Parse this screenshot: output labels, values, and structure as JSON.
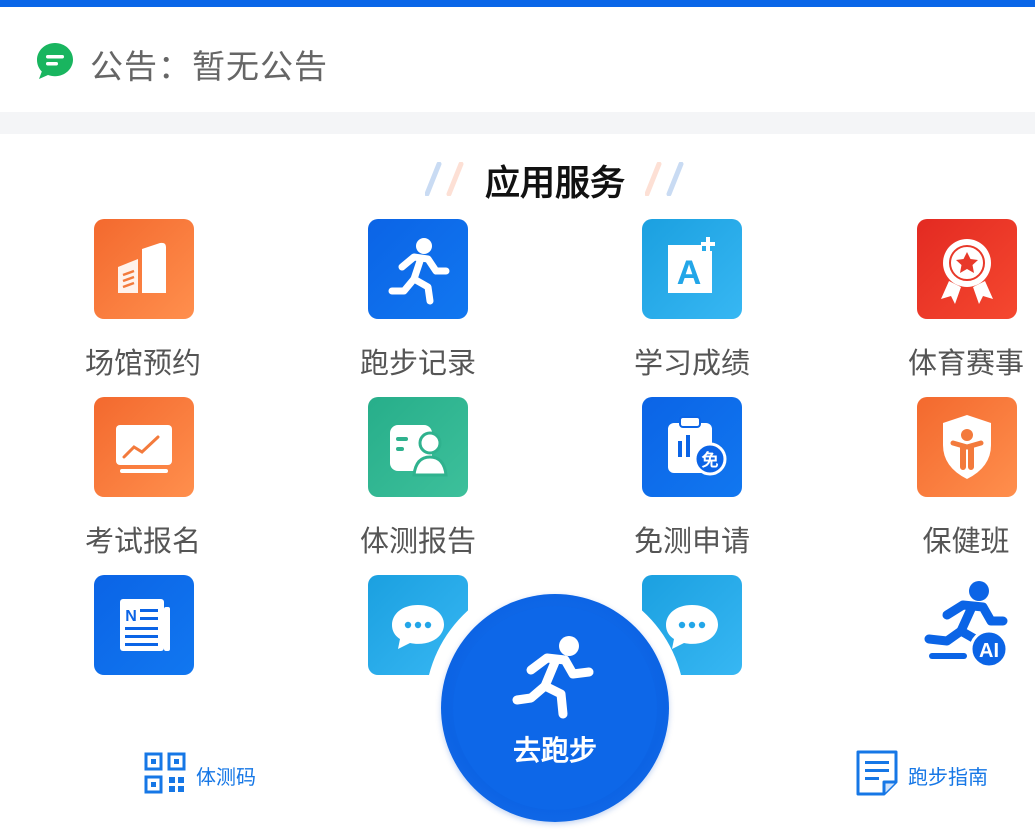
{
  "notice": {
    "text": "公告：暂无公告"
  },
  "section": {
    "title": "应用服务"
  },
  "services": [
    {
      "label": "场馆预约",
      "icon": "venue-building-icon"
    },
    {
      "label": "跑步记录",
      "icon": "running-person-icon"
    },
    {
      "label": "学习成绩",
      "icon": "grade-a-plus-icon"
    },
    {
      "label": "体育赛事",
      "icon": "award-medal-icon"
    },
    {
      "label": "考试报名",
      "icon": "trend-board-icon"
    },
    {
      "label": "体测报告",
      "icon": "report-person-icon"
    },
    {
      "label": "免测申请",
      "icon": "exempt-clipboard-icon"
    },
    {
      "label": "保健班",
      "icon": "health-shield-icon"
    },
    {
      "label": "",
      "icon": "news-icon"
    },
    {
      "label": "",
      "icon": "chat-bubble-icon"
    },
    {
      "label": "",
      "icon": "chat-bubble-icon"
    },
    {
      "label": "",
      "icon": "ai-runner-icon"
    }
  ],
  "run_button": {
    "label": "去跑步"
  },
  "bottom": {
    "left_label": "体测码",
    "right_label": "跑步指南"
  },
  "colors": {
    "brand_blue": "#0a66e8",
    "orange": "#f3692e",
    "green": "#27ae8a",
    "red": "#e32a22",
    "cyan": "#1ba0e0"
  }
}
